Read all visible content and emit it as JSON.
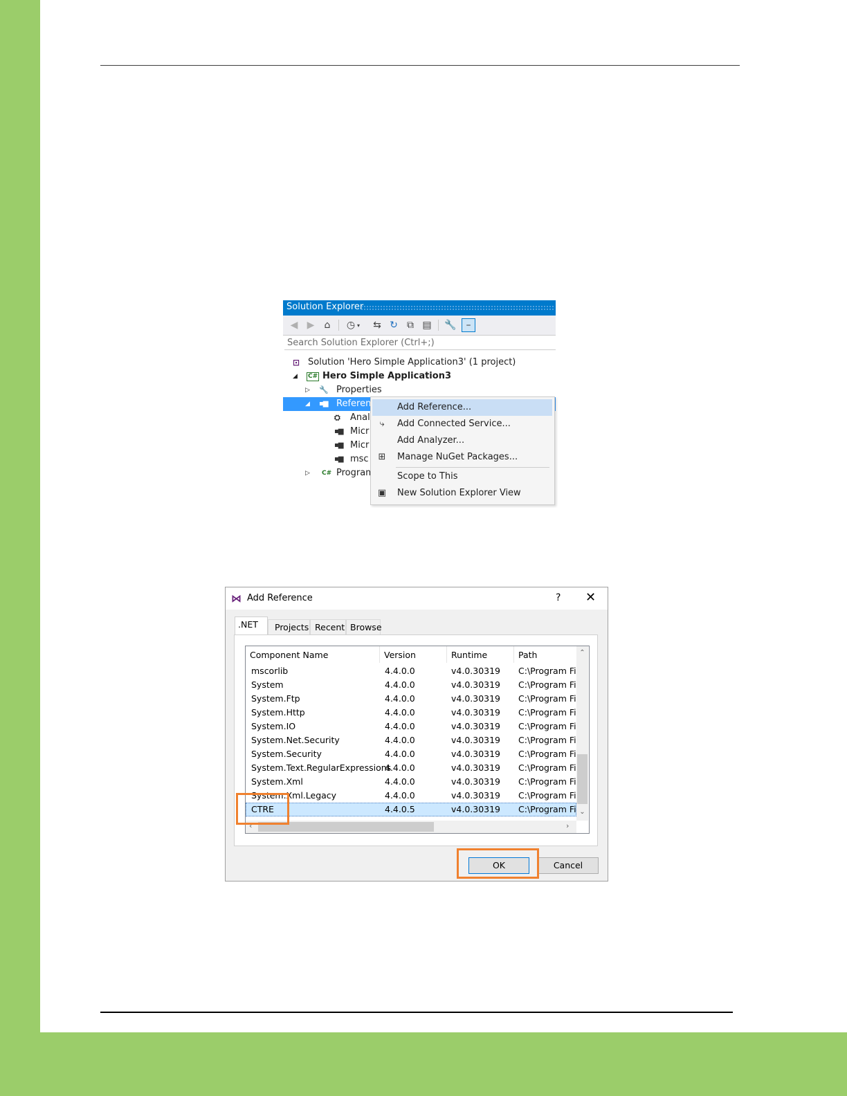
{
  "solution_explorer": {
    "title": "Solution Explorer",
    "search_placeholder": "Search Solution Explorer (Ctrl+;)",
    "tree": {
      "solution": "Solution 'Hero Simple Application3' (1 project)",
      "project": "Hero Simple Application3",
      "properties": "Properties",
      "references": "Referen",
      "children": [
        "Anal",
        "Micr",
        "Micr",
        "msc"
      ],
      "program": "Program"
    }
  },
  "context_menu": {
    "items": [
      {
        "label": "Add Reference...",
        "icon": "none"
      },
      {
        "label": "Add Connected Service...",
        "icon": "connected-service-icon"
      },
      {
        "label": "Add Analyzer...",
        "icon": "none"
      },
      {
        "label": "Manage NuGet Packages...",
        "icon": "nuget-icon"
      },
      {
        "label": "Scope to This",
        "icon": "none"
      },
      {
        "label": "New Solution Explorer View",
        "icon": "new-view-icon"
      }
    ]
  },
  "add_reference": {
    "title": "Add Reference",
    "help": "?",
    "close": "✕",
    "tabs": [
      ".NET",
      "Projects",
      "Recent",
      "Browse"
    ],
    "columns": [
      "Component Name",
      "Version",
      "Runtime",
      "Path"
    ],
    "rows": [
      [
        "mscorlib",
        "4.4.0.0",
        "v4.0.30319",
        "C:\\Program Fil"
      ],
      [
        "System",
        "4.4.0.0",
        "v4.0.30319",
        "C:\\Program Fil"
      ],
      [
        "System.Ftp",
        "4.4.0.0",
        "v4.0.30319",
        "C:\\Program Fil"
      ],
      [
        "System.Http",
        "4.4.0.0",
        "v4.0.30319",
        "C:\\Program Fil"
      ],
      [
        "System.IO",
        "4.4.0.0",
        "v4.0.30319",
        "C:\\Program Fil"
      ],
      [
        "System.Net.Security",
        "4.4.0.0",
        "v4.0.30319",
        "C:\\Program Fil"
      ],
      [
        "System.Security",
        "4.4.0.0",
        "v4.0.30319",
        "C:\\Program Fil"
      ],
      [
        "System.Text.RegularExpressions",
        "4.4.0.0",
        "v4.0.30319",
        "C:\\Program Fil"
      ],
      [
        "System.Xml",
        "4.4.0.0",
        "v4.0.30319",
        "C:\\Program Fil"
      ],
      [
        "System.Xml.Legacy",
        "4.4.0.0",
        "v4.0.30319",
        "C:\\Program Fil"
      ],
      [
        "CTRE",
        "4.4.0.5",
        "v4.0.30319",
        "C:\\Program Fil"
      ]
    ],
    "ok_label": "OK",
    "cancel_label": "Cancel"
  },
  "colors": {
    "page_green": "#9bcd6a",
    "vs_blue": "#007acc",
    "selection_blue": "#3399ff",
    "highlight_orange": "#f0812f"
  }
}
